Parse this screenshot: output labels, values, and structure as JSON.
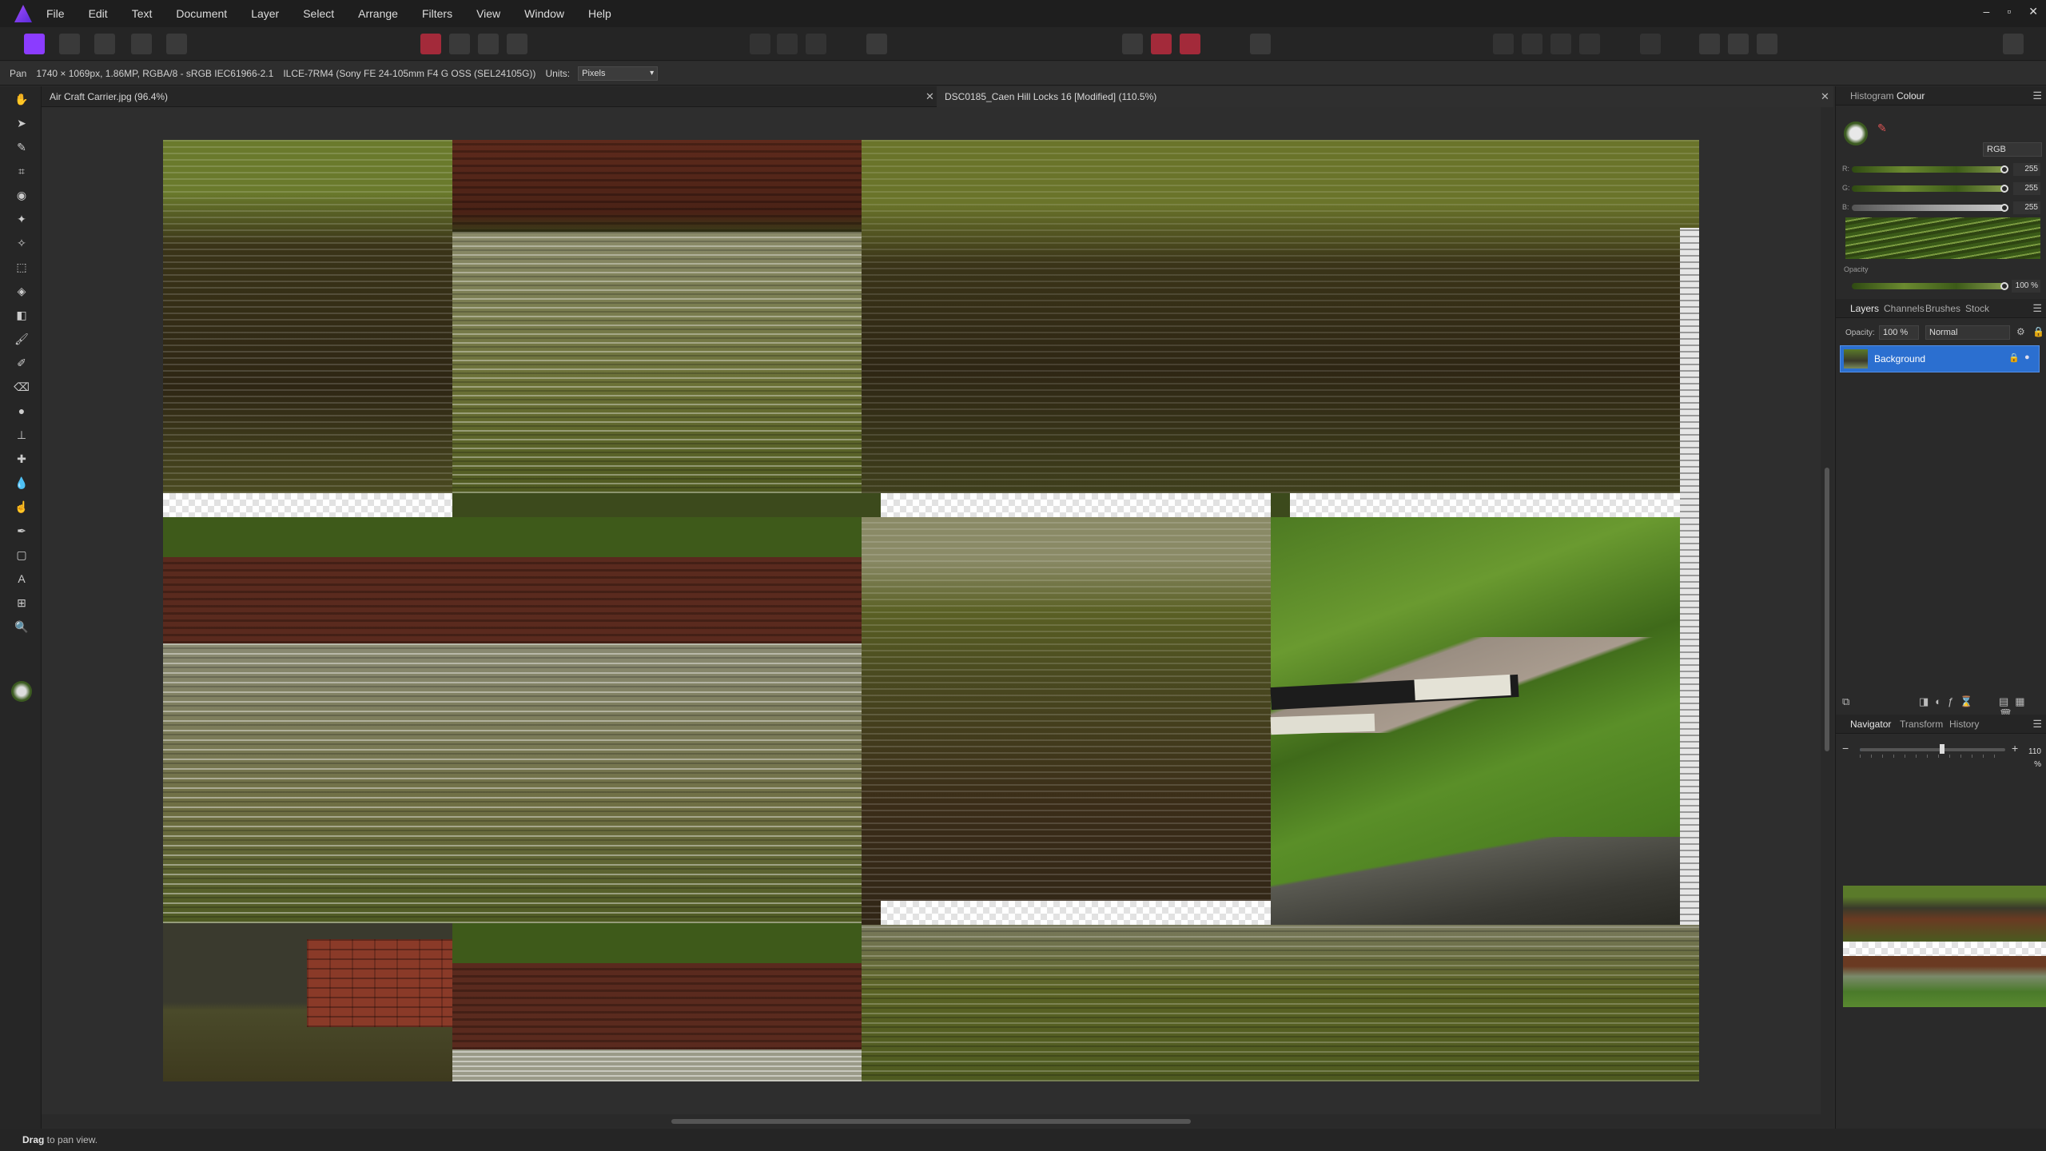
{
  "menu": [
    "File",
    "Edit",
    "Text",
    "Document",
    "Layer",
    "Select",
    "Arrange",
    "Filters",
    "View",
    "Window",
    "Help"
  ],
  "window_controls": [
    "–",
    "▫",
    "✕"
  ],
  "context": {
    "tool": "Pan",
    "doc_info": "1740 × 1069px, 1.86MP, RGBA/8 - sRGB IEC61966-2.1",
    "camera": "ILCE-7RM4 (Sony FE 24-105mm F4 G OSS (SEL24105G))",
    "units_label": "Units:",
    "units_value": "Pixels"
  },
  "tabs": [
    {
      "label": "Air Craft Carrier.jpg (96.4%)"
    },
    {
      "label": "DSC0185_Caen Hill Locks 16 [Modified] (110.5%)"
    }
  ],
  "tab_close": "✕",
  "status": {
    "bold": "Drag",
    "text": " to pan view."
  },
  "colour_panel": {
    "tabs": [
      "Histogram",
      "Colour"
    ],
    "mode": "RGB",
    "channels": [
      {
        "label": "R:",
        "value": "255",
        "level": 1.0
      },
      {
        "label": "G:",
        "value": "255",
        "level": 1.0
      },
      {
        "label": "B:",
        "value": "255",
        "level": 1.0
      }
    ],
    "opacity_label": "Opacity",
    "opacity_value": "100 %",
    "opacity_level": 1.0
  },
  "layers_panel": {
    "tabs": [
      "Layers",
      "Channels",
      "Brushes",
      "Stock"
    ],
    "opacity_label": "Opacity:",
    "opacity_value": "100 %",
    "blend_mode": "Normal",
    "layers": [
      {
        "name": "Background"
      }
    ]
  },
  "navigator_panel": {
    "tabs": [
      "Navigator",
      "Transform",
      "History"
    ],
    "zoom_value": "110 %",
    "zoom_level": 0.55
  },
  "colors": {
    "accent": "#8b3cff",
    "selection": "#2b6fd0",
    "grass": "#4f7a1e",
    "brick": "#6a2a1e"
  }
}
